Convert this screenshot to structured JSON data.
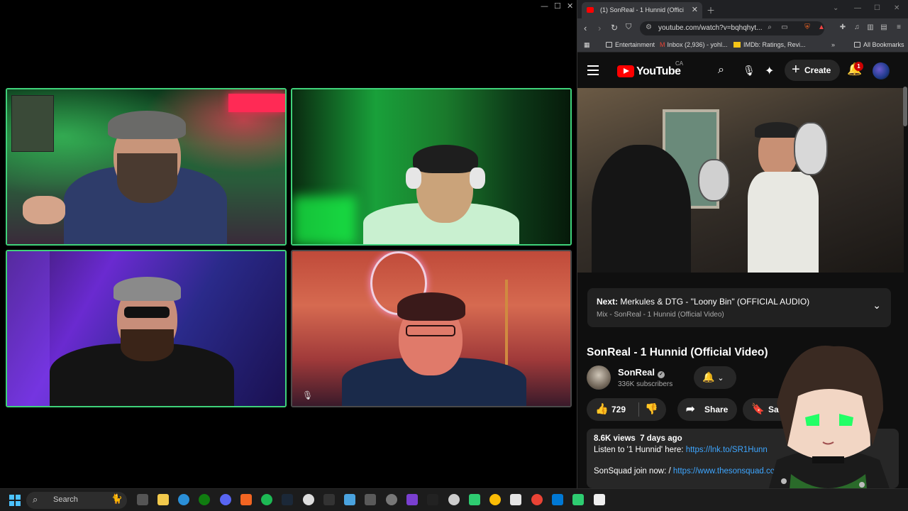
{
  "browser": {
    "tab_title": "(1) SonReal - 1 Hunnid (Offici",
    "url": "youtube.com/watch?v=bqhqhyt...",
    "bookmarks": [
      "Entertainment",
      "Inbox (2,936) - yohl...",
      "IMDb: Ratings, Revi...",
      "All Bookmarks"
    ]
  },
  "youtube": {
    "logo_text": "YouTube",
    "region": "CA",
    "create_label": "Create",
    "notification_count": "1",
    "next": {
      "label": "Next:",
      "title": "Merkules & DTG - \"Loony Bin\" (OFFICIAL AUDIO)",
      "subtitle": "Mix - SonReal - 1 Hunnid (Official Video)"
    },
    "video_title": "SonReal - 1 Hunnid (Official Video)",
    "channel": {
      "name": "SonReal",
      "subscribers": "336K subscribers"
    },
    "likes": "729",
    "share_label": "Share",
    "save_label": "Save",
    "description": {
      "views": "8.6K views",
      "age": "7 days ago",
      "line1_text": "Listen to '1 Hunnid' here: ",
      "line1_link": "https://lnk.to/SR1Hunn",
      "line2_text": "SonSquad join now: / ",
      "line2_link": "https://www.thesonsquad.com"
    }
  },
  "taskbar": {
    "search_label": "Search"
  },
  "colors": {
    "active_speaker_border": "#3fd27a",
    "yt_red": "#ff0000",
    "link_blue": "#3ea6ff"
  }
}
